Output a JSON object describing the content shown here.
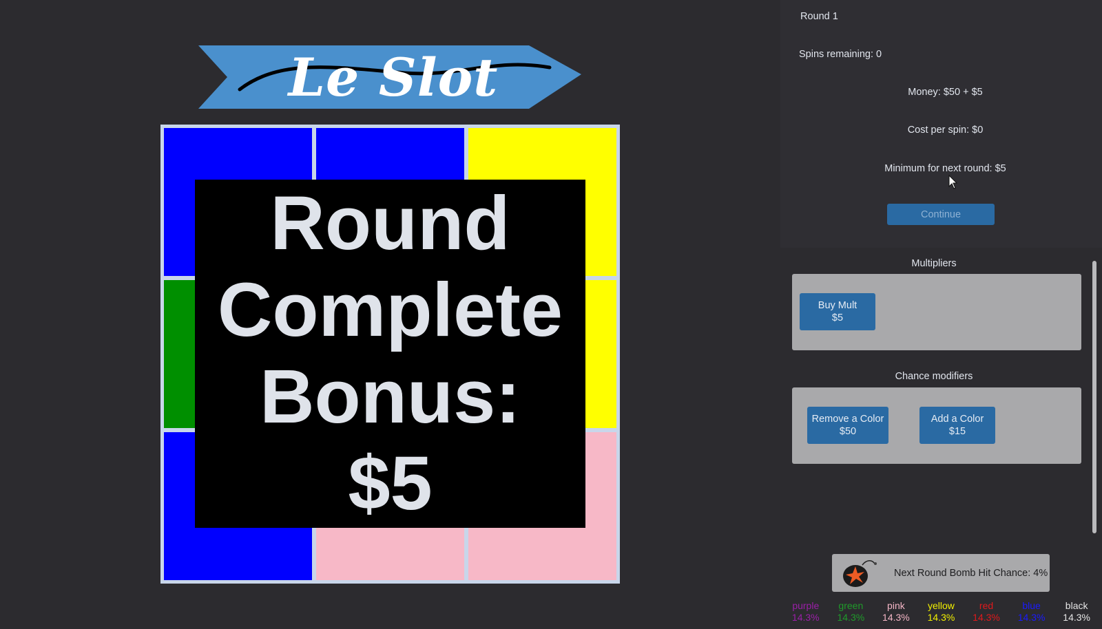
{
  "game": {
    "title": "Le Slot",
    "banner_color": "#4a90cd",
    "grid_cells": [
      {
        "color": "blue",
        "hex": "#0000ff"
      },
      {
        "color": "blue",
        "hex": "#0000ff"
      },
      {
        "color": "yellow",
        "hex": "#ffff00"
      },
      {
        "color": "green",
        "hex": "#008f00"
      },
      {
        "color": "yellow",
        "hex": "#ffff00"
      },
      {
        "color": "yellow",
        "hex": "#ffff00"
      },
      {
        "color": "blue",
        "hex": "#0000ff"
      },
      {
        "color": "pink",
        "hex": "#f7b8c7"
      },
      {
        "color": "pink",
        "hex": "#f7b8c7"
      }
    ],
    "overlay": {
      "line1": "Round",
      "line2": "Complete",
      "line3": "Bonus:",
      "line4": "$5"
    }
  },
  "status": {
    "round": "Round 1",
    "spins": "Spins remaining: 0",
    "money": "Money: $50 + $5",
    "cost": "Cost per spin: $0",
    "minimum": "Minimum for next round: $5",
    "continue_label": "Continue"
  },
  "shop": {
    "multipliers_title": "Multipliers",
    "buy_mult": {
      "line1": "Buy Mult",
      "line2": "$5"
    },
    "chance_title": "Chance modifiers",
    "remove_color": {
      "line1": "Remove a Color",
      "line2": "$50"
    },
    "add_color": {
      "line1": "Add a Color",
      "line2": "$15"
    }
  },
  "bomb": {
    "text": "Next Round Bomb Hit Chance: 4%",
    "icon": "bomb-icon"
  },
  "odds": [
    {
      "name": "purple",
      "pct": "14.3%",
      "color": "#9b1fa8"
    },
    {
      "name": "green",
      "pct": "14.3%",
      "color": "#1f9b2a"
    },
    {
      "name": "pink",
      "pct": "14.3%",
      "color": "#f4b6c6"
    },
    {
      "name": "yellow",
      "pct": "14.3%",
      "color": "#f2f000"
    },
    {
      "name": "red",
      "pct": "14.3%",
      "color": "#e0191c"
    },
    {
      "name": "blue",
      "pct": "14.3%",
      "color": "#1a1aff"
    },
    {
      "name": "black",
      "pct": "14.3%",
      "color": "#e6e6e6"
    }
  ]
}
